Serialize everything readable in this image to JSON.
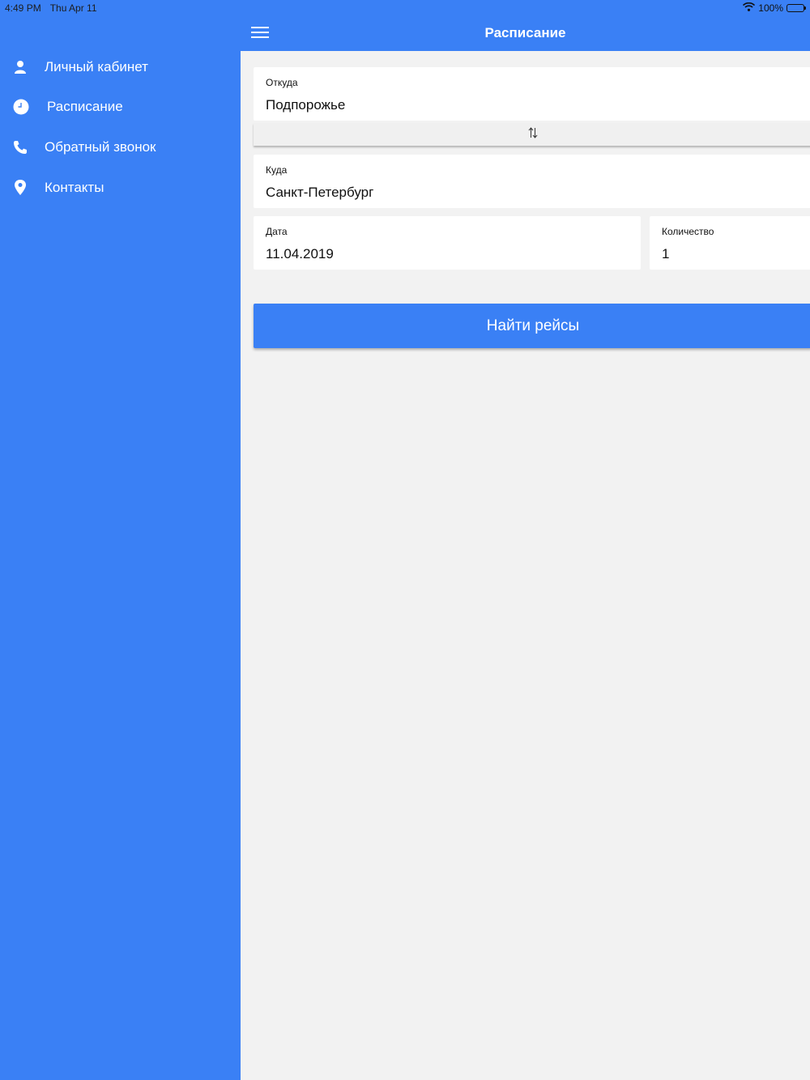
{
  "status_bar": {
    "time": "4:49 PM",
    "date": "Thu Apr 11",
    "battery": "100%"
  },
  "sidebar": {
    "items": [
      {
        "label": "Личный кабинет",
        "icon": "person-icon"
      },
      {
        "label": "Расписание",
        "icon": "clock-icon"
      },
      {
        "label": "Обратный звонок",
        "icon": "phone-icon"
      },
      {
        "label": "Контакты",
        "icon": "location-pin-icon"
      }
    ]
  },
  "header": {
    "title": "Расписание"
  },
  "form": {
    "from": {
      "label": "Откуда",
      "value": "Подпорожье"
    },
    "to": {
      "label": "Куда",
      "value": "Санкт-Петербург"
    },
    "date": {
      "label": "Дата",
      "value": "11.04.2019"
    },
    "count": {
      "label": "Количество",
      "value": "1"
    },
    "swap_icon": "swap-vertical-icon",
    "search_label": "Найти рейсы"
  },
  "colors": {
    "primary": "#3a80f5",
    "background": "#f2f2f2",
    "text": "#111111"
  }
}
